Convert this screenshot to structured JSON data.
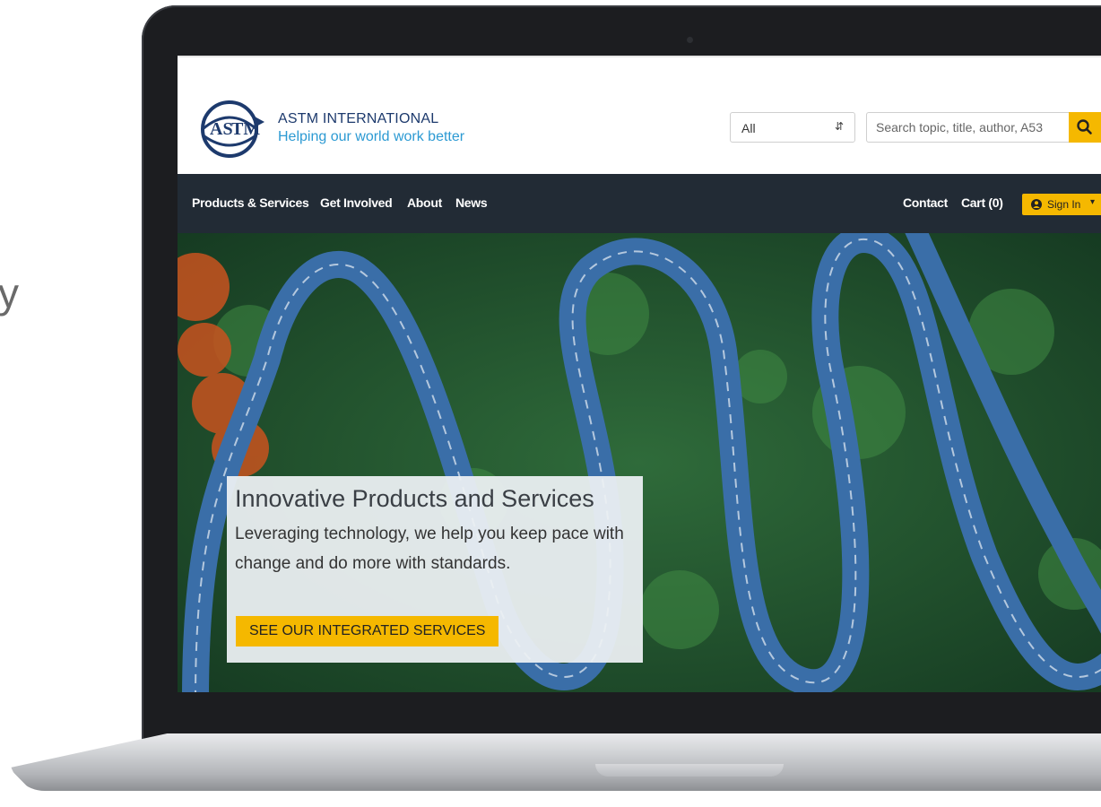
{
  "edge_glyph": "y",
  "header": {
    "brand_name": "ASTM INTERNATIONAL",
    "tagline": "Helping our world work better",
    "search_scope": "All",
    "search_placeholder": "Search topic, title, author, A53",
    "brand_color": "#1d3a6d",
    "accent_color": "#f5b800"
  },
  "nav": {
    "items": [
      "Products & Services",
      "Get Involved",
      "About",
      "News"
    ],
    "contact": "Contact",
    "cart": "Cart (0)",
    "sign_in": "Sign In"
  },
  "hero": {
    "title": "Innovative Products and Services",
    "body": "Leveraging technology, we help you keep pace with change and do more with standards.",
    "cta": "SEE OUR INTEGRATED SERVICES"
  },
  "icons": [
    "search-icon",
    "user-icon",
    "caret-down-icon",
    "select-arrows-icon"
  ]
}
